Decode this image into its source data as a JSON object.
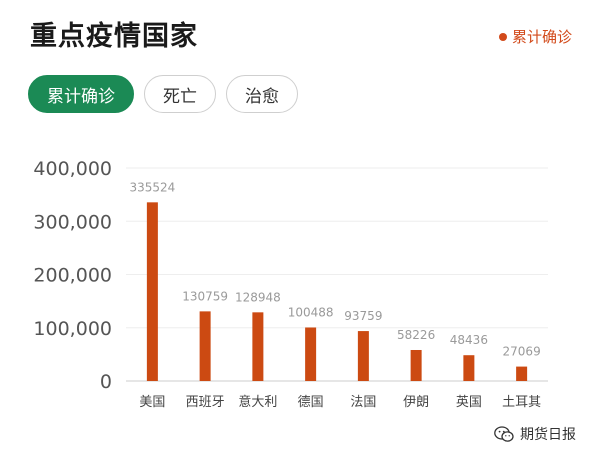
{
  "header": {
    "title": "重点疫情国家",
    "legend_label": "累计确诊",
    "legend_color": "#d24a1a"
  },
  "tabs": [
    {
      "label": "累计确诊",
      "active": true
    },
    {
      "label": "死亡",
      "active": false
    },
    {
      "label": "治愈",
      "active": false
    }
  ],
  "watermark": {
    "text": "期货日报",
    "icon": "wechat-icon"
  },
  "colors": {
    "accent": "#1b8a55",
    "bar": "#cc4a12"
  },
  "chart_data": {
    "type": "bar",
    "categories": [
      "美国",
      "西班牙",
      "意大利",
      "德国",
      "法国",
      "伊朗",
      "英国",
      "土耳其"
    ],
    "values": [
      335524,
      130759,
      128948,
      100488,
      93759,
      58226,
      48436,
      27069
    ],
    "ylim": [
      0,
      400000
    ],
    "yticks": [
      "0",
      "100,000",
      "200,000",
      "300,000",
      "400,000"
    ],
    "ytick_values": [
      0,
      100000,
      200000,
      300000,
      400000
    ],
    "grid": true,
    "legend": "top-right"
  }
}
